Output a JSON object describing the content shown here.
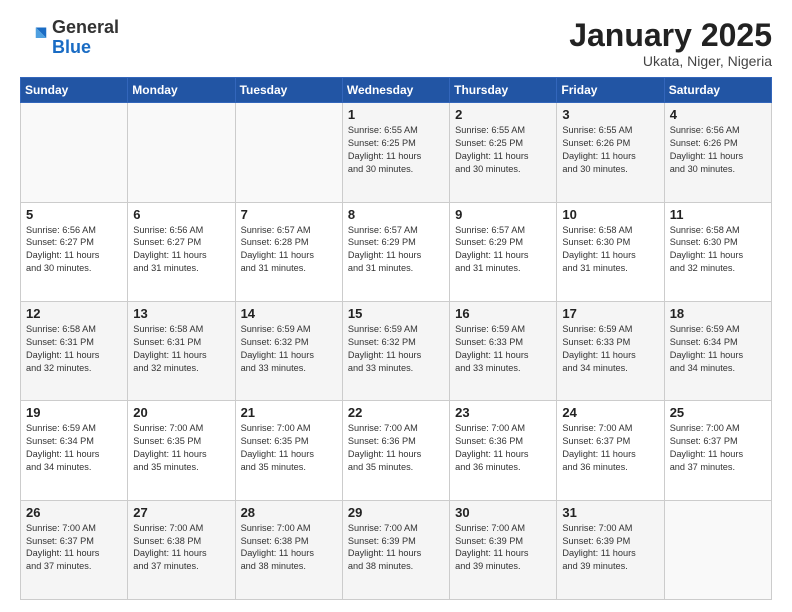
{
  "header": {
    "logo_general": "General",
    "logo_blue": "Blue",
    "month_title": "January 2025",
    "location": "Ukata, Niger, Nigeria"
  },
  "days_of_week": [
    "Sunday",
    "Monday",
    "Tuesday",
    "Wednesday",
    "Thursday",
    "Friday",
    "Saturday"
  ],
  "weeks": [
    [
      {
        "num": "",
        "info": ""
      },
      {
        "num": "",
        "info": ""
      },
      {
        "num": "",
        "info": ""
      },
      {
        "num": "1",
        "info": "Sunrise: 6:55 AM\nSunset: 6:25 PM\nDaylight: 11 hours\nand 30 minutes."
      },
      {
        "num": "2",
        "info": "Sunrise: 6:55 AM\nSunset: 6:25 PM\nDaylight: 11 hours\nand 30 minutes."
      },
      {
        "num": "3",
        "info": "Sunrise: 6:55 AM\nSunset: 6:26 PM\nDaylight: 11 hours\nand 30 minutes."
      },
      {
        "num": "4",
        "info": "Sunrise: 6:56 AM\nSunset: 6:26 PM\nDaylight: 11 hours\nand 30 minutes."
      }
    ],
    [
      {
        "num": "5",
        "info": "Sunrise: 6:56 AM\nSunset: 6:27 PM\nDaylight: 11 hours\nand 30 minutes."
      },
      {
        "num": "6",
        "info": "Sunrise: 6:56 AM\nSunset: 6:27 PM\nDaylight: 11 hours\nand 31 minutes."
      },
      {
        "num": "7",
        "info": "Sunrise: 6:57 AM\nSunset: 6:28 PM\nDaylight: 11 hours\nand 31 minutes."
      },
      {
        "num": "8",
        "info": "Sunrise: 6:57 AM\nSunset: 6:29 PM\nDaylight: 11 hours\nand 31 minutes."
      },
      {
        "num": "9",
        "info": "Sunrise: 6:57 AM\nSunset: 6:29 PM\nDaylight: 11 hours\nand 31 minutes."
      },
      {
        "num": "10",
        "info": "Sunrise: 6:58 AM\nSunset: 6:30 PM\nDaylight: 11 hours\nand 31 minutes."
      },
      {
        "num": "11",
        "info": "Sunrise: 6:58 AM\nSunset: 6:30 PM\nDaylight: 11 hours\nand 32 minutes."
      }
    ],
    [
      {
        "num": "12",
        "info": "Sunrise: 6:58 AM\nSunset: 6:31 PM\nDaylight: 11 hours\nand 32 minutes."
      },
      {
        "num": "13",
        "info": "Sunrise: 6:58 AM\nSunset: 6:31 PM\nDaylight: 11 hours\nand 32 minutes."
      },
      {
        "num": "14",
        "info": "Sunrise: 6:59 AM\nSunset: 6:32 PM\nDaylight: 11 hours\nand 33 minutes."
      },
      {
        "num": "15",
        "info": "Sunrise: 6:59 AM\nSunset: 6:32 PM\nDaylight: 11 hours\nand 33 minutes."
      },
      {
        "num": "16",
        "info": "Sunrise: 6:59 AM\nSunset: 6:33 PM\nDaylight: 11 hours\nand 33 minutes."
      },
      {
        "num": "17",
        "info": "Sunrise: 6:59 AM\nSunset: 6:33 PM\nDaylight: 11 hours\nand 34 minutes."
      },
      {
        "num": "18",
        "info": "Sunrise: 6:59 AM\nSunset: 6:34 PM\nDaylight: 11 hours\nand 34 minutes."
      }
    ],
    [
      {
        "num": "19",
        "info": "Sunrise: 6:59 AM\nSunset: 6:34 PM\nDaylight: 11 hours\nand 34 minutes."
      },
      {
        "num": "20",
        "info": "Sunrise: 7:00 AM\nSunset: 6:35 PM\nDaylight: 11 hours\nand 35 minutes."
      },
      {
        "num": "21",
        "info": "Sunrise: 7:00 AM\nSunset: 6:35 PM\nDaylight: 11 hours\nand 35 minutes."
      },
      {
        "num": "22",
        "info": "Sunrise: 7:00 AM\nSunset: 6:36 PM\nDaylight: 11 hours\nand 35 minutes."
      },
      {
        "num": "23",
        "info": "Sunrise: 7:00 AM\nSunset: 6:36 PM\nDaylight: 11 hours\nand 36 minutes."
      },
      {
        "num": "24",
        "info": "Sunrise: 7:00 AM\nSunset: 6:37 PM\nDaylight: 11 hours\nand 36 minutes."
      },
      {
        "num": "25",
        "info": "Sunrise: 7:00 AM\nSunset: 6:37 PM\nDaylight: 11 hours\nand 37 minutes."
      }
    ],
    [
      {
        "num": "26",
        "info": "Sunrise: 7:00 AM\nSunset: 6:37 PM\nDaylight: 11 hours\nand 37 minutes."
      },
      {
        "num": "27",
        "info": "Sunrise: 7:00 AM\nSunset: 6:38 PM\nDaylight: 11 hours\nand 37 minutes."
      },
      {
        "num": "28",
        "info": "Sunrise: 7:00 AM\nSunset: 6:38 PM\nDaylight: 11 hours\nand 38 minutes."
      },
      {
        "num": "29",
        "info": "Sunrise: 7:00 AM\nSunset: 6:39 PM\nDaylight: 11 hours\nand 38 minutes."
      },
      {
        "num": "30",
        "info": "Sunrise: 7:00 AM\nSunset: 6:39 PM\nDaylight: 11 hours\nand 39 minutes."
      },
      {
        "num": "31",
        "info": "Sunrise: 7:00 AM\nSunset: 6:39 PM\nDaylight: 11 hours\nand 39 minutes."
      },
      {
        "num": "",
        "info": ""
      }
    ]
  ]
}
